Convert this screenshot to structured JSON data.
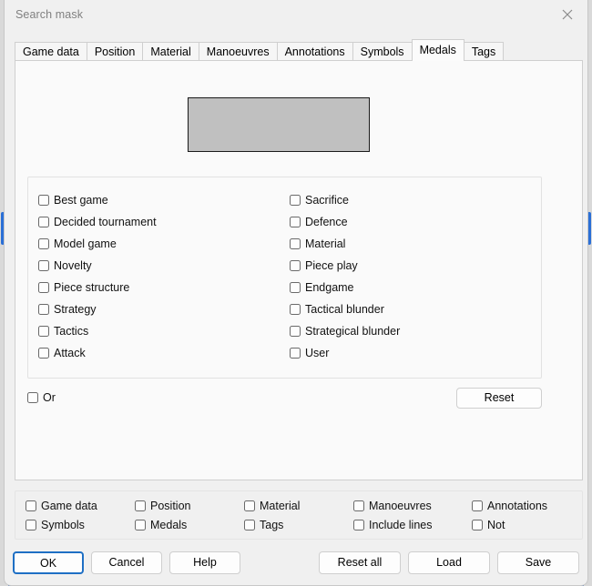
{
  "window": {
    "title": "Search mask",
    "close_icon": "close-icon"
  },
  "tabs": [
    {
      "label": "Game data",
      "active": false
    },
    {
      "label": "Position",
      "active": false
    },
    {
      "label": "Material",
      "active": false
    },
    {
      "label": "Manoeuvres",
      "active": false
    },
    {
      "label": "Annotations",
      "active": false
    },
    {
      "label": "Symbols",
      "active": false
    },
    {
      "label": "Medals",
      "active": true
    },
    {
      "label": "Tags",
      "active": false
    }
  ],
  "medals_tab": {
    "preview": {
      "fill_color": "#c0c0c0",
      "border_color": "#1a1a1a"
    },
    "left_column": [
      {
        "label": "Best game",
        "checked": false
      },
      {
        "label": "Decided tournament",
        "checked": false
      },
      {
        "label": "Model game",
        "checked": false
      },
      {
        "label": "Novelty",
        "checked": false
      },
      {
        "label": "Piece structure",
        "checked": false
      },
      {
        "label": "Strategy",
        "checked": false
      },
      {
        "label": "Tactics",
        "checked": false
      },
      {
        "label": "Attack",
        "checked": false
      }
    ],
    "right_column": [
      {
        "label": "Sacrifice",
        "checked": false
      },
      {
        "label": "Defence",
        "checked": false
      },
      {
        "label": "Material",
        "checked": false
      },
      {
        "label": "Piece play",
        "checked": false
      },
      {
        "label": "Endgame",
        "checked": false
      },
      {
        "label": "Tactical blunder",
        "checked": false
      },
      {
        "label": "Strategical blunder",
        "checked": false
      },
      {
        "label": "User",
        "checked": false
      }
    ],
    "or_checkbox": {
      "label": "Or",
      "checked": false
    },
    "reset_button": "Reset"
  },
  "sections": {
    "row1": [
      {
        "label": "Game data",
        "checked": false
      },
      {
        "label": "Position",
        "checked": false
      },
      {
        "label": "Material",
        "checked": false
      },
      {
        "label": "Manoeuvres",
        "checked": false
      },
      {
        "label": "Annotations",
        "checked": false
      }
    ],
    "row2": [
      {
        "label": "Symbols",
        "checked": false
      },
      {
        "label": "Medals",
        "checked": false
      },
      {
        "label": "Tags",
        "checked": false
      },
      {
        "label": "Include lines",
        "checked": false
      },
      {
        "label": "Not",
        "checked": false
      }
    ]
  },
  "buttons": {
    "ok": "OK",
    "cancel": "Cancel",
    "help": "Help",
    "reset_all": "Reset all",
    "load": "Load",
    "save": "Save",
    "focus_color": "#1e6fc4"
  }
}
